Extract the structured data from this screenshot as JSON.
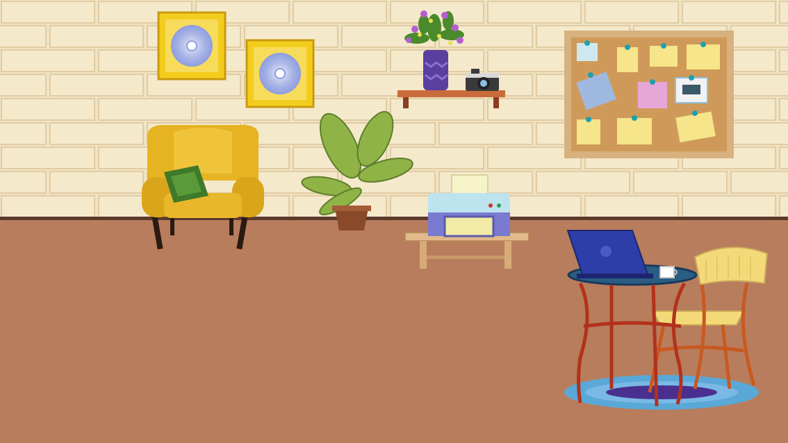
{
  "scene": {
    "colors": {
      "wall": "#f1e3c2",
      "wall_brick_line": "#e2cfa6",
      "floor": "#b87d5d",
      "baseboard": "#5a3a2a",
      "frame_gold": "#f2cd1d",
      "armchair": "#e6b422",
      "pillow": "#3f7a2a",
      "plant_leaf": "#8fb347",
      "pot": "#8a4a2a",
      "shelf": "#c96c3a",
      "vase": "#5b3fa0",
      "corkboard": "#cf9a59",
      "corkboard_frame": "#d7b17e",
      "printer": "#bde3ef",
      "bench": "#e2b98a",
      "laptop": "#2d3ea8",
      "table_top": "#2b5d83",
      "table_legs": "#b3311c",
      "chair_seat": "#f4d978",
      "chair_frame": "#c85a20",
      "rug": "#5aa8d8",
      "rug_inner": "#4a2f8f"
    },
    "objects": [
      "gold-frame-cd-icon",
      "gold-frame-cd-icon",
      "yellow-armchair-icon",
      "green-pillow-icon",
      "potted-plant-icon",
      "wall-shelf-icon",
      "flower-vase-icon",
      "camera-icon",
      "corkboard-icon",
      "printer-icon",
      "wooden-bench-icon",
      "laptop-icon",
      "coffee-mug-icon",
      "bistro-table-icon",
      "wicker-chair-icon",
      "oval-rug-icon"
    ]
  }
}
